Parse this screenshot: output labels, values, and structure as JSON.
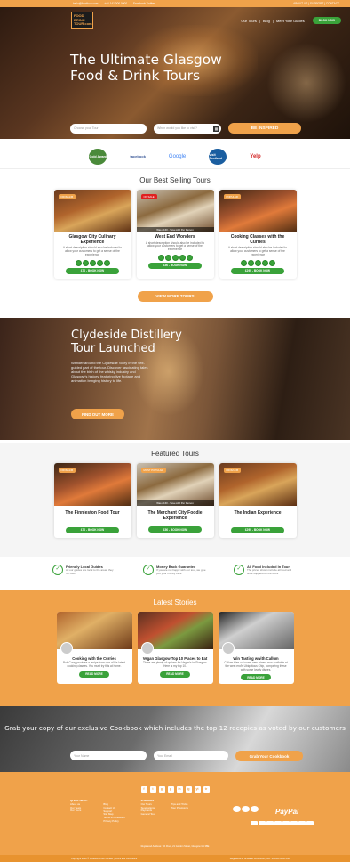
{
  "topbar": {
    "email": "hello@foodtour.com",
    "phone": "+44 141 000 0000",
    "social": "Facebook  Twitter",
    "right": "ABOUT US  |  SUPPORT  |  CONTACT"
  },
  "nav": {
    "logo": "FOOD DRINK TOUR.com",
    "links": [
      "Our Tours",
      "Blog",
      "Meet Your Guides"
    ],
    "book": "BOOK NOW"
  },
  "hero": {
    "title": "The Ultimate Glasgow Food & Drink Tours",
    "tour_placeholder": "Choose your Tour",
    "date_placeholder": "When would you like to visit?",
    "cta": "BE INSPIRED"
  },
  "logos": [
    "Gold Award",
    "facebook",
    "Google",
    "Visit Scotland",
    "Yelp"
  ],
  "best": {
    "title": "Our Best Selling Tours",
    "cards": [
      {
        "tag": "FROM £45",
        "title": "Glasgow City Culinary Experience",
        "desc": "A short description should also be included to allow your customers to get a sense of the experience",
        "price": "£70 - BOOK NOW"
      },
      {
        "tag": "ON SALE",
        "strip": "Was £160 - Save £10 Per Person",
        "title": "West End Wonders",
        "desc": "A short description should also be included to allow your customers to get a sense of the experience",
        "price": "£50 - BOOK NOW"
      },
      {
        "tag": "POPULAR",
        "title": "Cooking Classes with the Curries",
        "desc": "A short description should also be included to allow your customers to get a sense of the experience",
        "price": "£295 - BOOK NOW"
      }
    ],
    "more": "VIEW MORE TOURS"
  },
  "distillery": {
    "title": "Clydeside Distillery Tour Launched",
    "text": "Wander around the Clydeside Story in the self-guided part of the tour. Discover fascinating tales about the birth of the whisky industry and Glasgow's history, featuring live footage and animation bringing history to life.",
    "cta": "FIND OUT MORE"
  },
  "featured": {
    "title": "Featured Tours",
    "cards": [
      {
        "tag": "FROM £45",
        "title": "The Finnieston Food Tour",
        "price": "£70 - BOOK NOW"
      },
      {
        "tag": "MOST POPULAR",
        "strip": "Was £160 - Save £10 Per Person",
        "title": "The Merchant City Foodie Experience",
        "price": "£50 - BOOK NOW"
      },
      {
        "tag": "FROM £45",
        "title": "The Indian Experience",
        "price": "£295 - BOOK NOW"
      }
    ]
  },
  "features": [
    {
      "title": "Friendly Local Guides",
      "text": "All our guides are local to the areas they run tours"
    },
    {
      "title": "Money Back Guarantee",
      "text": "If you are not happy with our tour, we give you your money back"
    },
    {
      "title": "All Food Included In Tour",
      "text": "The prices shown include all food and drink supplied on the tours"
    }
  ],
  "stories": {
    "title": "Latest Stories",
    "items": [
      {
        "title": "Cooking with the Curries",
        "text": "Bob Curry provides a recipe from one of his latest cooking classes. You must try this at home.",
        "btn": "READ MORE"
      },
      {
        "title": "Vegan Glasgow Top 10 Places to Eat",
        "text": "There are plenty of options for Vegan's in Glasgow. Here is my top 10.",
        "btn": "READ MORE"
      },
      {
        "title": "Win Tasting wwith Callum",
        "text": "Callum tries out some new wines, now available at the west end's Ubiquitous Chip, comparing these with some lovely dishes.",
        "btn": "READ MORE"
      }
    ]
  },
  "cookbook": {
    "title": "Grab your copy of our exclusive Cookbook which includes the top 12 recepies as voted by our customers",
    "name_placeholder": "Your Name",
    "email_placeholder": "Your Email",
    "cta": "Grab Your Cookbook"
  },
  "footer": {
    "social": [
      "f",
      "t",
      "g",
      "p",
      "in",
      "ig",
      "yt",
      "tr"
    ],
    "col1_title": "QUICK MENU",
    "col1": [
      "About us",
      "Our Team",
      "Our Tours"
    ],
    "col2": [
      "Blog",
      "Contact Us",
      "Support",
      "Site Map",
      "Terms & Conditions",
      "Privacy Policy"
    ],
    "col3_title": "SUPPORT",
    "col3": [
      "Our Tours",
      "Suggestions",
      "Payments",
      "General Tour"
    ],
    "col4": [
      "Tips and Tricks",
      "Tour Provisions"
    ],
    "paypal": "PayPal",
    "reg": "Registered Address: 7th Floor, 21 Gordon Street, Glasgow G1 3BE",
    "copyright": "Copyright 2019 © FoodDrinkTour Limited  |  Terms and Conditions",
    "company": "Registered in Scotland SC000000  |  VAT: 000000 0000 000"
  },
  "colors": {
    "accent": "#f0a24a",
    "green": "#3aa23a"
  }
}
